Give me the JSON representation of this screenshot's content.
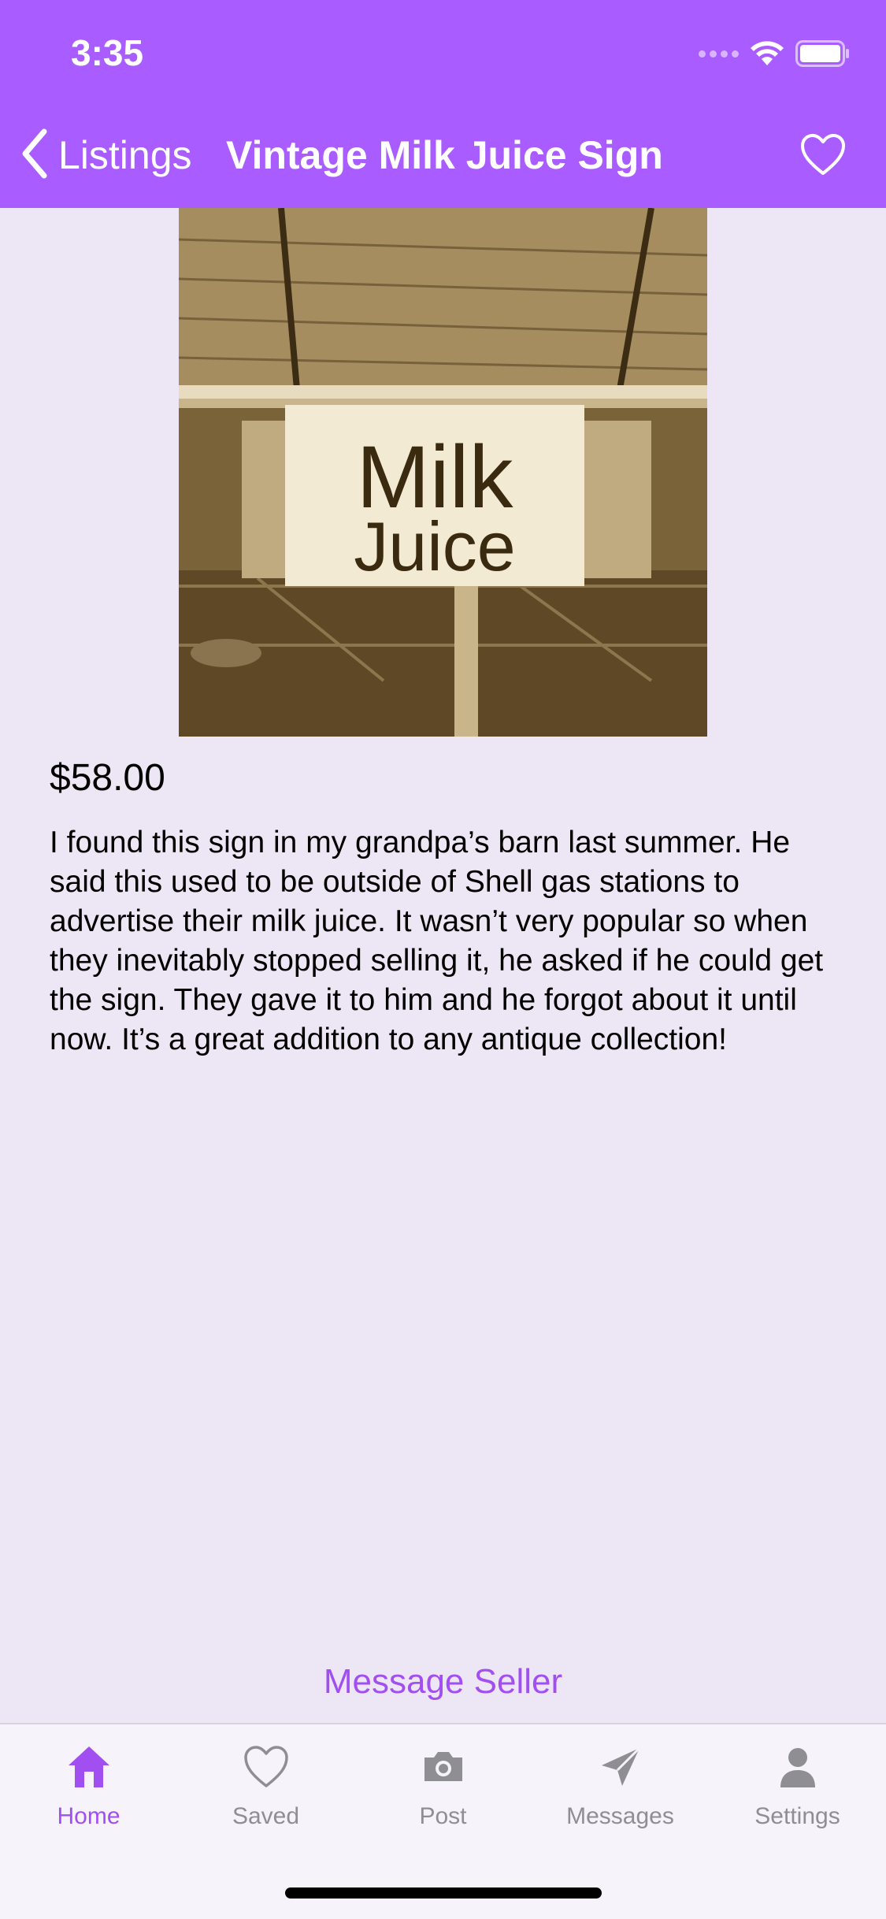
{
  "status_bar": {
    "time": "3:35",
    "icons": [
      "signal-icon",
      "wifi-icon",
      "battery-icon"
    ]
  },
  "nav": {
    "back_label": "Listings",
    "title": "Vintage Milk Juice Sign",
    "icons": [
      "chevron-left-icon",
      "heart-outline-icon"
    ]
  },
  "listing": {
    "image": {
      "sign_line1": "Milk",
      "sign_line2": "Juice"
    },
    "price": "$58.00",
    "description": "I found this sign in my grandpa’s barn last summer. He said this used to be outside of Shell gas stations to advertise their milk juice. It wasn’t very popular so when they inevitably stopped selling it, he asked if he could get the sign. They gave it to him and he forgot about it until now. It’s a great addition to any antique collection!"
  },
  "actions": {
    "message_seller": "Message Seller"
  },
  "tabbar": {
    "tabs": [
      {
        "label": "Home",
        "icon": "home-icon",
        "active": true
      },
      {
        "label": "Saved",
        "icon": "heart-icon",
        "active": false
      },
      {
        "label": "Post",
        "icon": "camera-icon",
        "active": false
      },
      {
        "label": "Messages",
        "icon": "paper-plane-icon",
        "active": false
      },
      {
        "label": "Settings",
        "icon": "person-icon",
        "active": false
      }
    ]
  },
  "colors": {
    "accent": "#a95cff",
    "accent_text": "#a24ff2",
    "background": "#ede6f5",
    "tab_inactive": "#8e8e93"
  }
}
